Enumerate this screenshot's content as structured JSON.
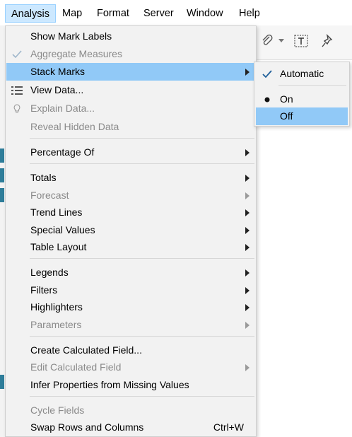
{
  "menubar": {
    "items": [
      "Analysis",
      "Map",
      "Format",
      "Server",
      "Window",
      "Help"
    ]
  },
  "analysis_menu": {
    "items": [
      {
        "label": "Show Mark Labels"
      },
      {
        "label": "Aggregate Measures"
      },
      {
        "label": "Stack Marks"
      },
      {
        "label": "View Data..."
      },
      {
        "label": "Explain Data..."
      },
      {
        "label": "Reveal Hidden Data"
      },
      {
        "label": "Percentage Of"
      },
      {
        "label": "Totals"
      },
      {
        "label": "Forecast"
      },
      {
        "label": "Trend Lines"
      },
      {
        "label": "Special Values"
      },
      {
        "label": "Table Layout"
      },
      {
        "label": "Legends"
      },
      {
        "label": "Filters"
      },
      {
        "label": "Highlighters"
      },
      {
        "label": "Parameters"
      },
      {
        "label": "Create Calculated Field..."
      },
      {
        "label": "Edit Calculated Field"
      },
      {
        "label": "Infer Properties from Missing Values"
      },
      {
        "label": "Cycle Fields"
      },
      {
        "label": "Swap Rows and Columns",
        "shortcut": "Ctrl+W"
      }
    ]
  },
  "stack_marks_submenu": {
    "items": [
      {
        "label": "Automatic"
      },
      {
        "label": "On"
      },
      {
        "label": "Off"
      }
    ]
  },
  "colors": {
    "highlight": "#91c9f7",
    "menu_bg": "#f2f2f2",
    "disabled_text": "#8a8a8a",
    "active_menubar": "#cce8ff"
  }
}
